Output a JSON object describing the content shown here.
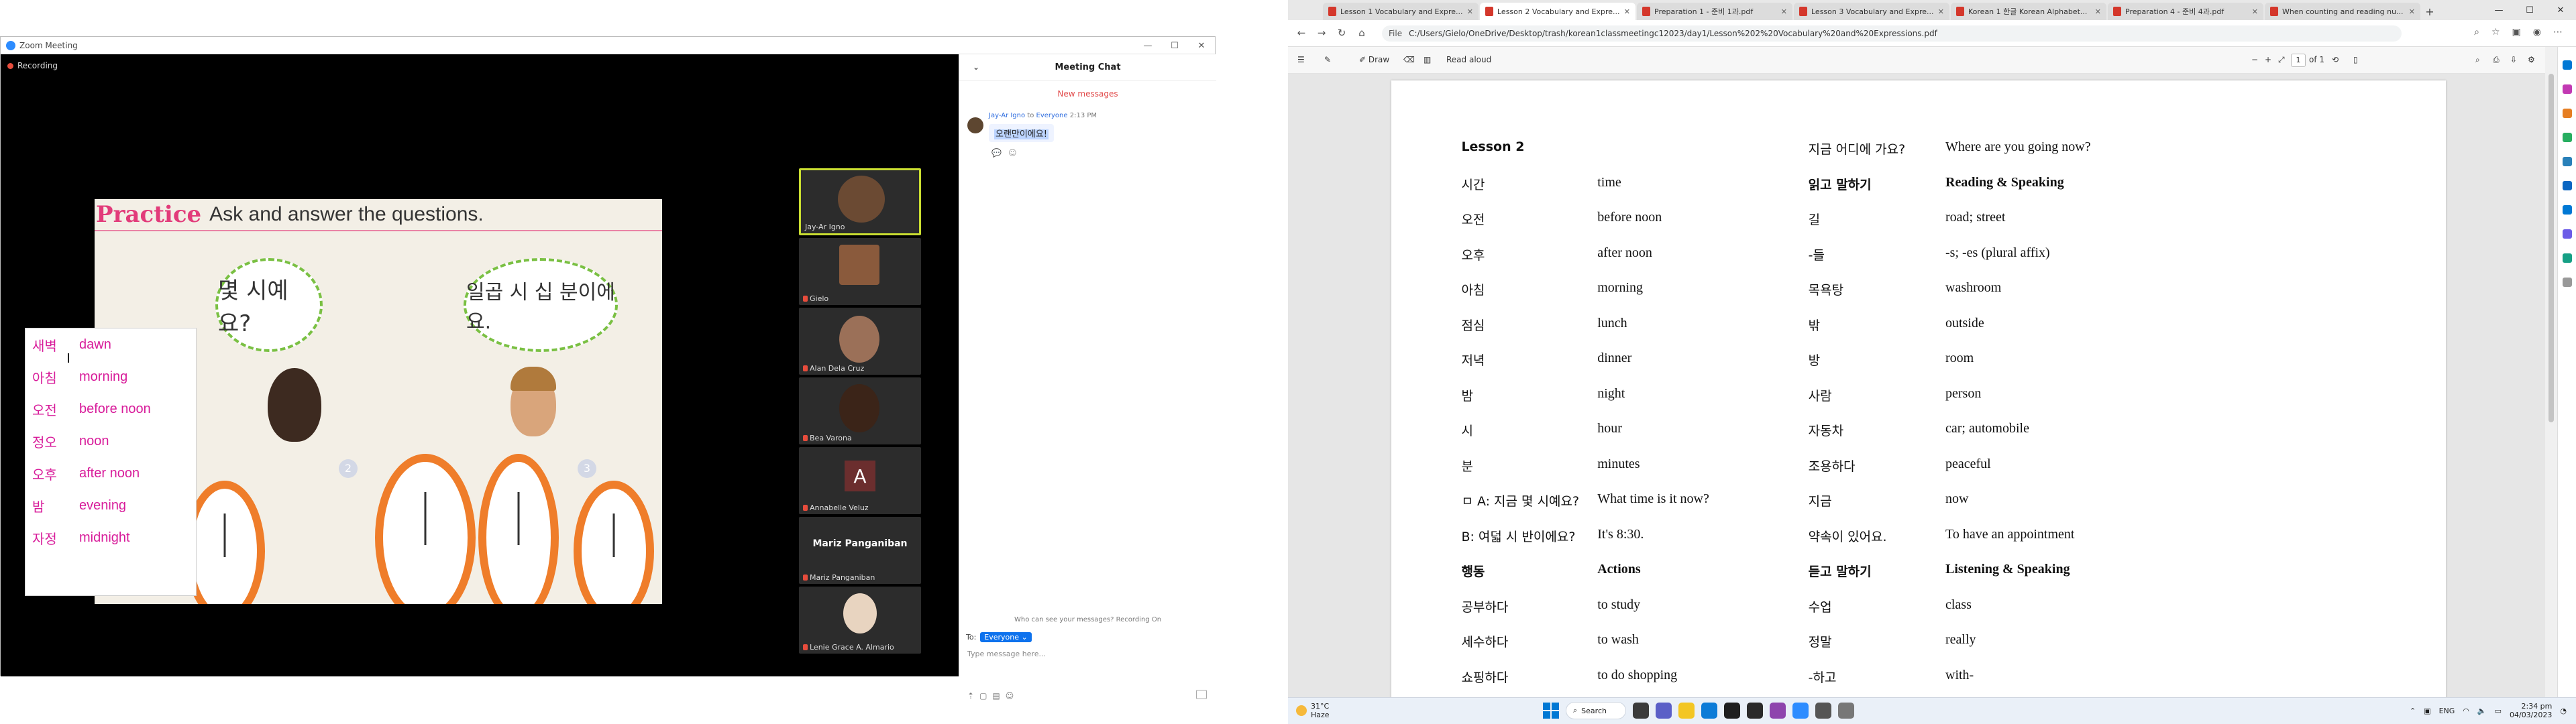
{
  "zoom": {
    "window_title": "Zoom Meeting",
    "recording_label": "Recording",
    "slide": {
      "practice": "Practice",
      "subtitle": "Ask and answer the questions.",
      "bubble_left": "몇 시예요?",
      "bubble_right": "일곱 시 십 분이에요."
    },
    "vocab": [
      {
        "ko": "새벽",
        "en": "dawn"
      },
      {
        "ko": "아침",
        "en": "morning"
      },
      {
        "ko": "오전",
        "en": "before noon"
      },
      {
        "ko": "정오",
        "en": "noon"
      },
      {
        "ko": "오후",
        "en": "after noon"
      },
      {
        "ko": "밤",
        "en": "evening"
      },
      {
        "ko": "자정",
        "en": "midnight"
      }
    ],
    "participants": [
      {
        "name": "Jay-Ar Igno"
      },
      {
        "name": "Gielo"
      },
      {
        "name": "Alan Dela Cruz"
      },
      {
        "name": "Bea Varona"
      },
      {
        "name": "Annabelle Veluz",
        "initial": "A"
      },
      {
        "name": "Mariz Panganiban",
        "bigname": "Mariz Panganiban"
      },
      {
        "name": "Lenie Grace A. Almario"
      }
    ],
    "chat": {
      "title": "Meeting Chat",
      "new_messages": "New messages",
      "sender": "Jay-Ar Igno",
      "to_word": "to",
      "recipient": "Everyone",
      "time": "2:13 PM",
      "message": "오랜만이에요!",
      "privacy": "Who can see your messages? Recording On",
      "to_label": "To:",
      "to_value": "Everyone",
      "placeholder": "Type message here..."
    }
  },
  "browser": {
    "tabs": [
      {
        "title": "Lesson 1 Vocabulary and Expre..."
      },
      {
        "title": "Lesson 2 Vocabulary and Expre...",
        "active": true
      },
      {
        "title": "Preparation 1 - 준비 1과.pdf"
      },
      {
        "title": "Lesson 3 Vocabulary and Expre..."
      },
      {
        "title": "Korean 1 한글 Korean Alphabet..."
      },
      {
        "title": "Preparation 4 - 준비 4과.pdf"
      },
      {
        "title": "When counting and reading nu..."
      }
    ],
    "url_prefix": "File",
    "url": "C:/Users/Gielo/OneDrive/Desktop/trash/korean1classmeetingc12023/day1/Lesson%202%20Vocabulary%20and%20Expressions.pdf",
    "pdf_toolbar": {
      "draw": "Draw",
      "read_aloud": "Read aloud",
      "page_current": "1",
      "page_total": "of 1"
    }
  },
  "document": {
    "left": [
      {
        "ko": "Lesson 2",
        "en": "",
        "bold": true
      },
      {
        "ko": "시간",
        "en": "time"
      },
      {
        "ko": "오전",
        "en": "before noon"
      },
      {
        "ko": "오후",
        "en": "after noon"
      },
      {
        "ko": "아침",
        "en": "morning"
      },
      {
        "ko": "점심",
        "en": "lunch"
      },
      {
        "ko": "저녁",
        "en": "dinner"
      },
      {
        "ko": "밤",
        "en": "night"
      },
      {
        "ko": "시",
        "en": "hour"
      },
      {
        "ko": "분",
        "en": "minutes"
      },
      {
        "ko": "ㅁ A: 지금 몇 시예요?",
        "en": "What time is it now?"
      },
      {
        "ko": "B: 여덟 시 반이에요?",
        "en": "It's 8:30."
      },
      {
        "ko": "행동",
        "en": "Actions",
        "bold": true
      },
      {
        "ko": "공부하다",
        "en": "to study"
      },
      {
        "ko": "세수하다",
        "en": "to wash"
      },
      {
        "ko": "쇼핑하다",
        "en": "to do shopping"
      }
    ],
    "right": [
      {
        "ko": "지금 어디에 가요?",
        "en": "Where are you going now?"
      },
      {
        "ko": "읽고 말하기",
        "en": "Reading & Speaking",
        "bold": true
      },
      {
        "ko": "길",
        "en": "road; street"
      },
      {
        "ko": "-들",
        "en": "-s; -es (plural affix)"
      },
      {
        "ko": "목욕탕",
        "en": "washroom"
      },
      {
        "ko": "밖",
        "en": "outside"
      },
      {
        "ko": "방",
        "en": "room"
      },
      {
        "ko": "사람",
        "en": "person"
      },
      {
        "ko": "자동차",
        "en": "car; automobile"
      },
      {
        "ko": "조용하다",
        "en": "peaceful"
      },
      {
        "ko": "지금",
        "en": "now"
      },
      {
        "ko": "약속이 있어요.",
        "en": "To have an appointment"
      },
      {
        "ko": "듣고 말하기",
        "en": "Listening & Speaking",
        "bold": true
      },
      {
        "ko": "수업",
        "en": "class"
      },
      {
        "ko": "정말",
        "en": "really"
      },
      {
        "ko": "-하고",
        "en": "with-"
      }
    ]
  },
  "taskbar": {
    "temperature": "31°C",
    "condition": "Haze",
    "search": "Search",
    "lang": "ENG",
    "time": "2:34 pm",
    "date": "04/03/2023"
  }
}
